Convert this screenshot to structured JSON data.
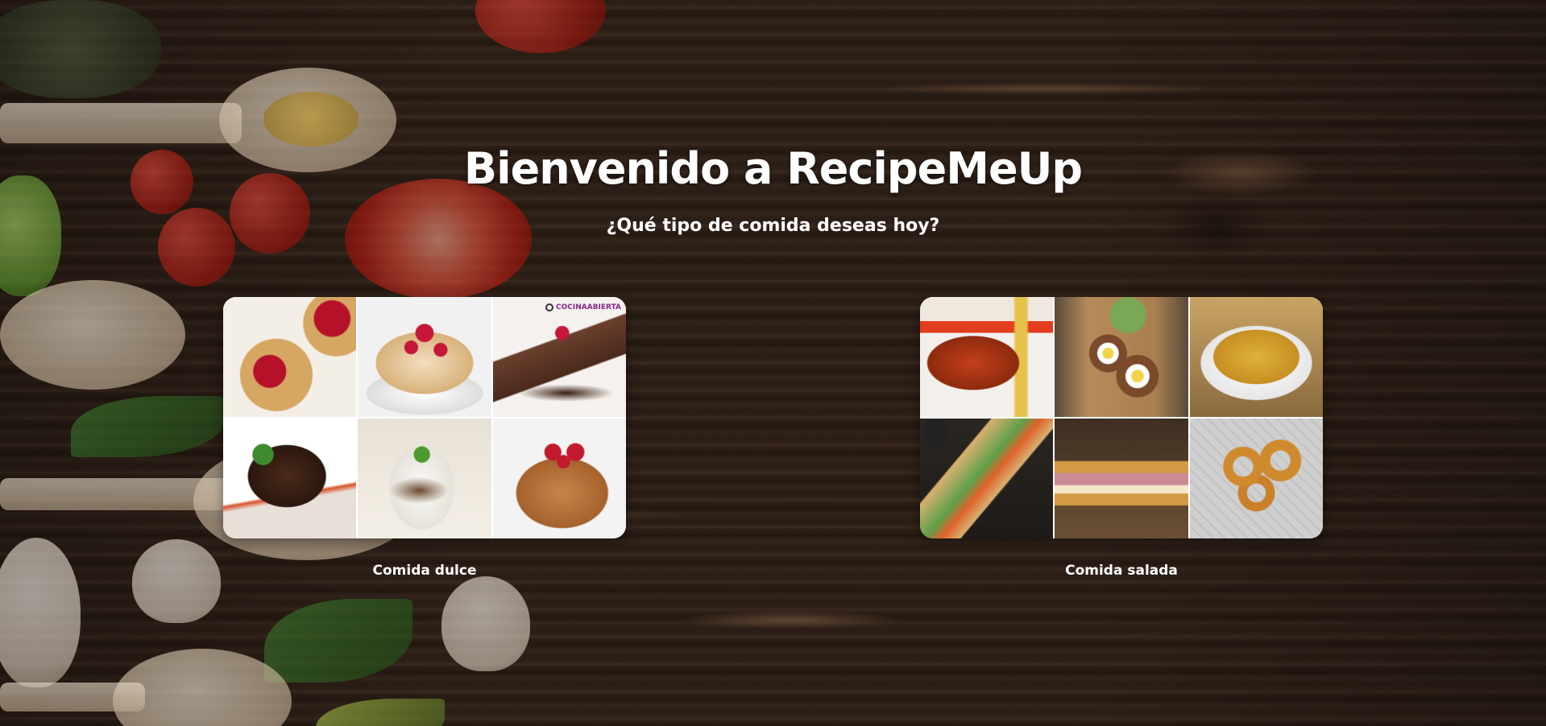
{
  "header": {
    "title": "Bienvenido a RecipeMeUp",
    "subtitle": "¿Qué tipo de comida deseas hoy?"
  },
  "categories": [
    {
      "label": "Comida dulce",
      "photos": [
        "raspberry-tartlets",
        "meringue-raspberry-cake",
        "chocolate-mousse-slice",
        "lava-cake",
        "yogurt-parfait",
        "bundt-cake-strawberries"
      ],
      "watermark": "COCINAABIERTA"
    },
    {
      "label": "Comida salada",
      "photos": [
        "currywurst-fries",
        "scotch-eggs",
        "nachos-bowl",
        "banh-mi-sandwich",
        "club-sandwich",
        "onion-rings-basket"
      ]
    }
  ]
}
